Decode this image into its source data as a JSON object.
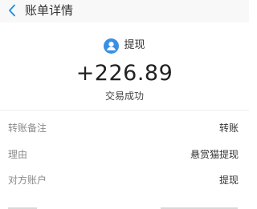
{
  "header": {
    "title": "账单详情",
    "back_icon": "chevron-left-icon",
    "accent_color": "#1a8fe0"
  },
  "payee": {
    "avatar_icon": "user-avatar-icon",
    "avatar_color": "#3a8ee6",
    "name": "提现"
  },
  "transaction": {
    "amount": "+226.89",
    "status": "交易成功"
  },
  "details": [
    {
      "label": "转账备注",
      "value": "转账"
    },
    {
      "label": "理由",
      "value": "悬赏猫提现"
    },
    {
      "label": "对方账户",
      "value": "提现"
    }
  ]
}
